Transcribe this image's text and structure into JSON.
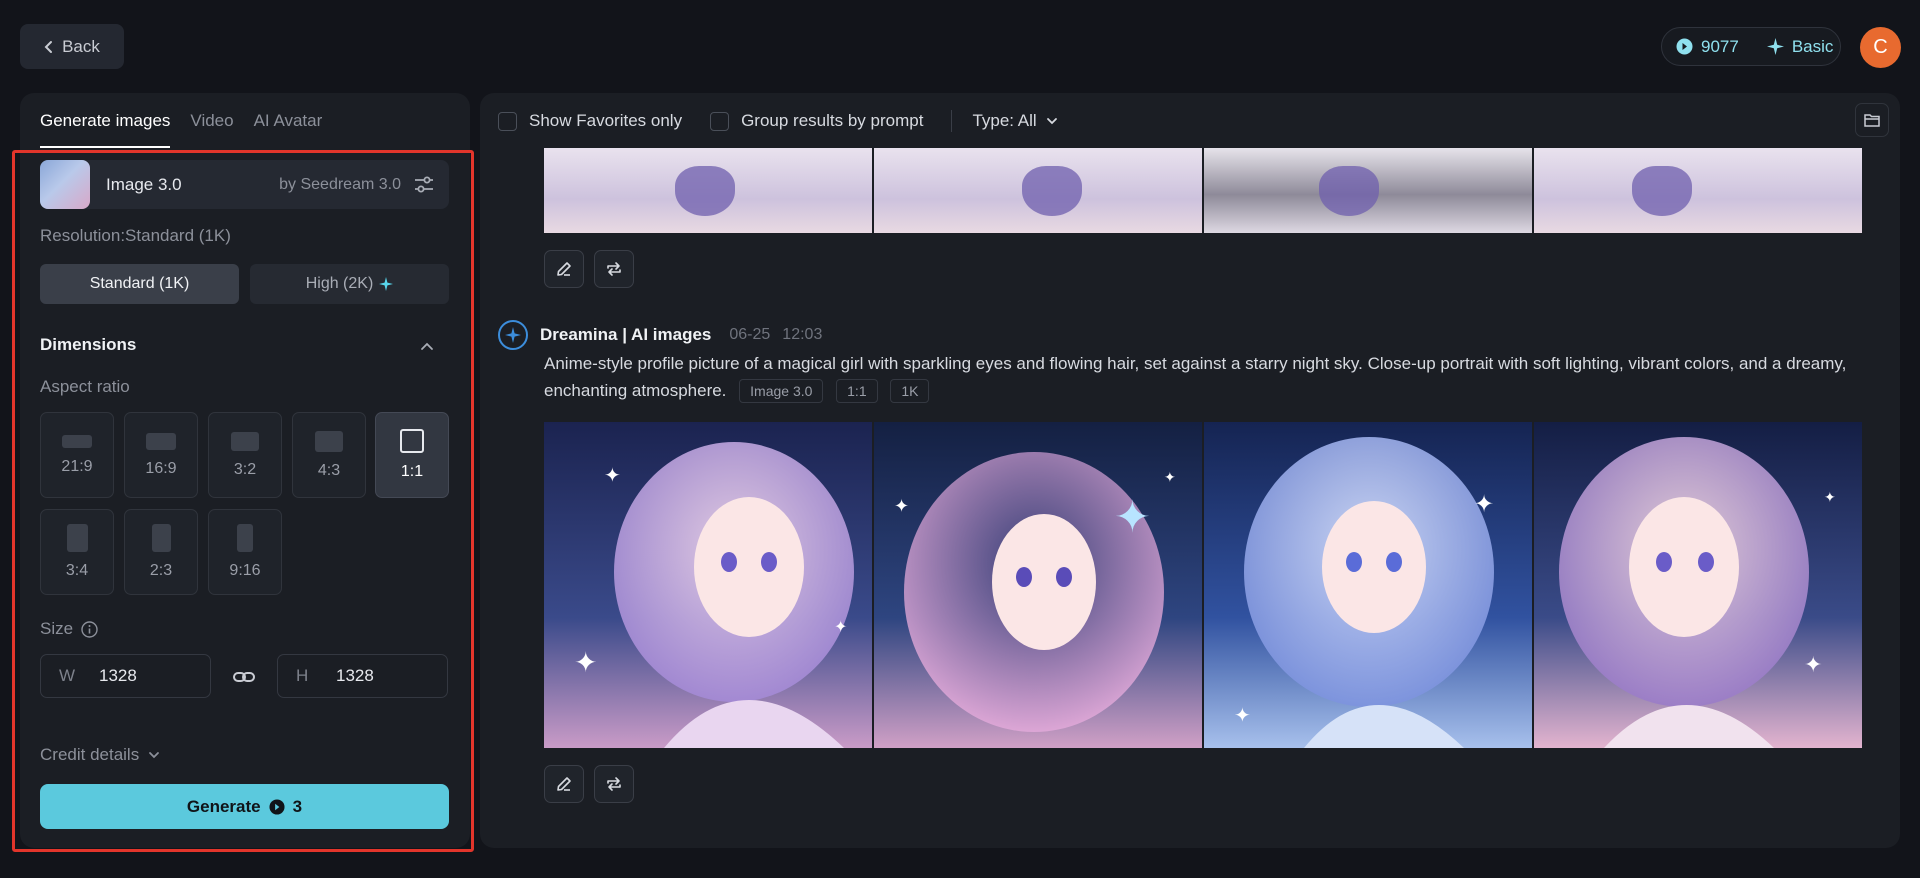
{
  "header": {
    "back_label": "Back",
    "credits": "9077",
    "plan": "Basic",
    "avatar_initial": "C"
  },
  "left_panel": {
    "tabs": [
      {
        "label": "Generate images",
        "active": true
      },
      {
        "label": "Video",
        "active": false
      },
      {
        "label": "AI Avatar",
        "active": false
      }
    ],
    "model": {
      "name": "Image 3.0",
      "by": "by Seedream 3.0"
    },
    "resolution_label": "Resolution:Standard (1K)",
    "resolution_options": [
      {
        "label": "Standard (1K)",
        "selected": true
      },
      {
        "label": "High (2K)",
        "selected": false
      }
    ],
    "dimensions_title": "Dimensions",
    "aspect_ratio_label": "Aspect ratio",
    "ratios": [
      {
        "label": "21:9",
        "selected": false
      },
      {
        "label": "16:9",
        "selected": false
      },
      {
        "label": "3:2",
        "selected": false
      },
      {
        "label": "4:3",
        "selected": false
      },
      {
        "label": "1:1",
        "selected": true
      },
      {
        "label": "3:4",
        "selected": false
      },
      {
        "label": "2:3",
        "selected": false
      },
      {
        "label": "9:16",
        "selected": false
      }
    ],
    "size_label": "Size",
    "width": {
      "prefix": "W",
      "value": "1328"
    },
    "height": {
      "prefix": "H",
      "value": "1328"
    },
    "credit_details_label": "Credit details",
    "generate_label": "Generate",
    "generate_cost": "3"
  },
  "right_panel": {
    "filters": {
      "favorites_label": "Show Favorites only",
      "group_label": "Group results by prompt",
      "type_label": "Type: All"
    },
    "generation": {
      "title": "Dreamina | AI images",
      "date": "06-25",
      "time": "12:03",
      "prompt": "Anime-style profile picture of a magical girl with sparkling eyes and flowing hair, set against a starry night sky. Close-up portrait with soft lighting, vibrant colors, and a dreamy, enchanting atmosphere.",
      "tags": [
        "Image 3.0",
        "1:1",
        "1K"
      ]
    }
  },
  "colors": {
    "accent": "#5bc9dd",
    "highlight_border": "#e2352b",
    "avatar_bg": "#e86a2f"
  }
}
